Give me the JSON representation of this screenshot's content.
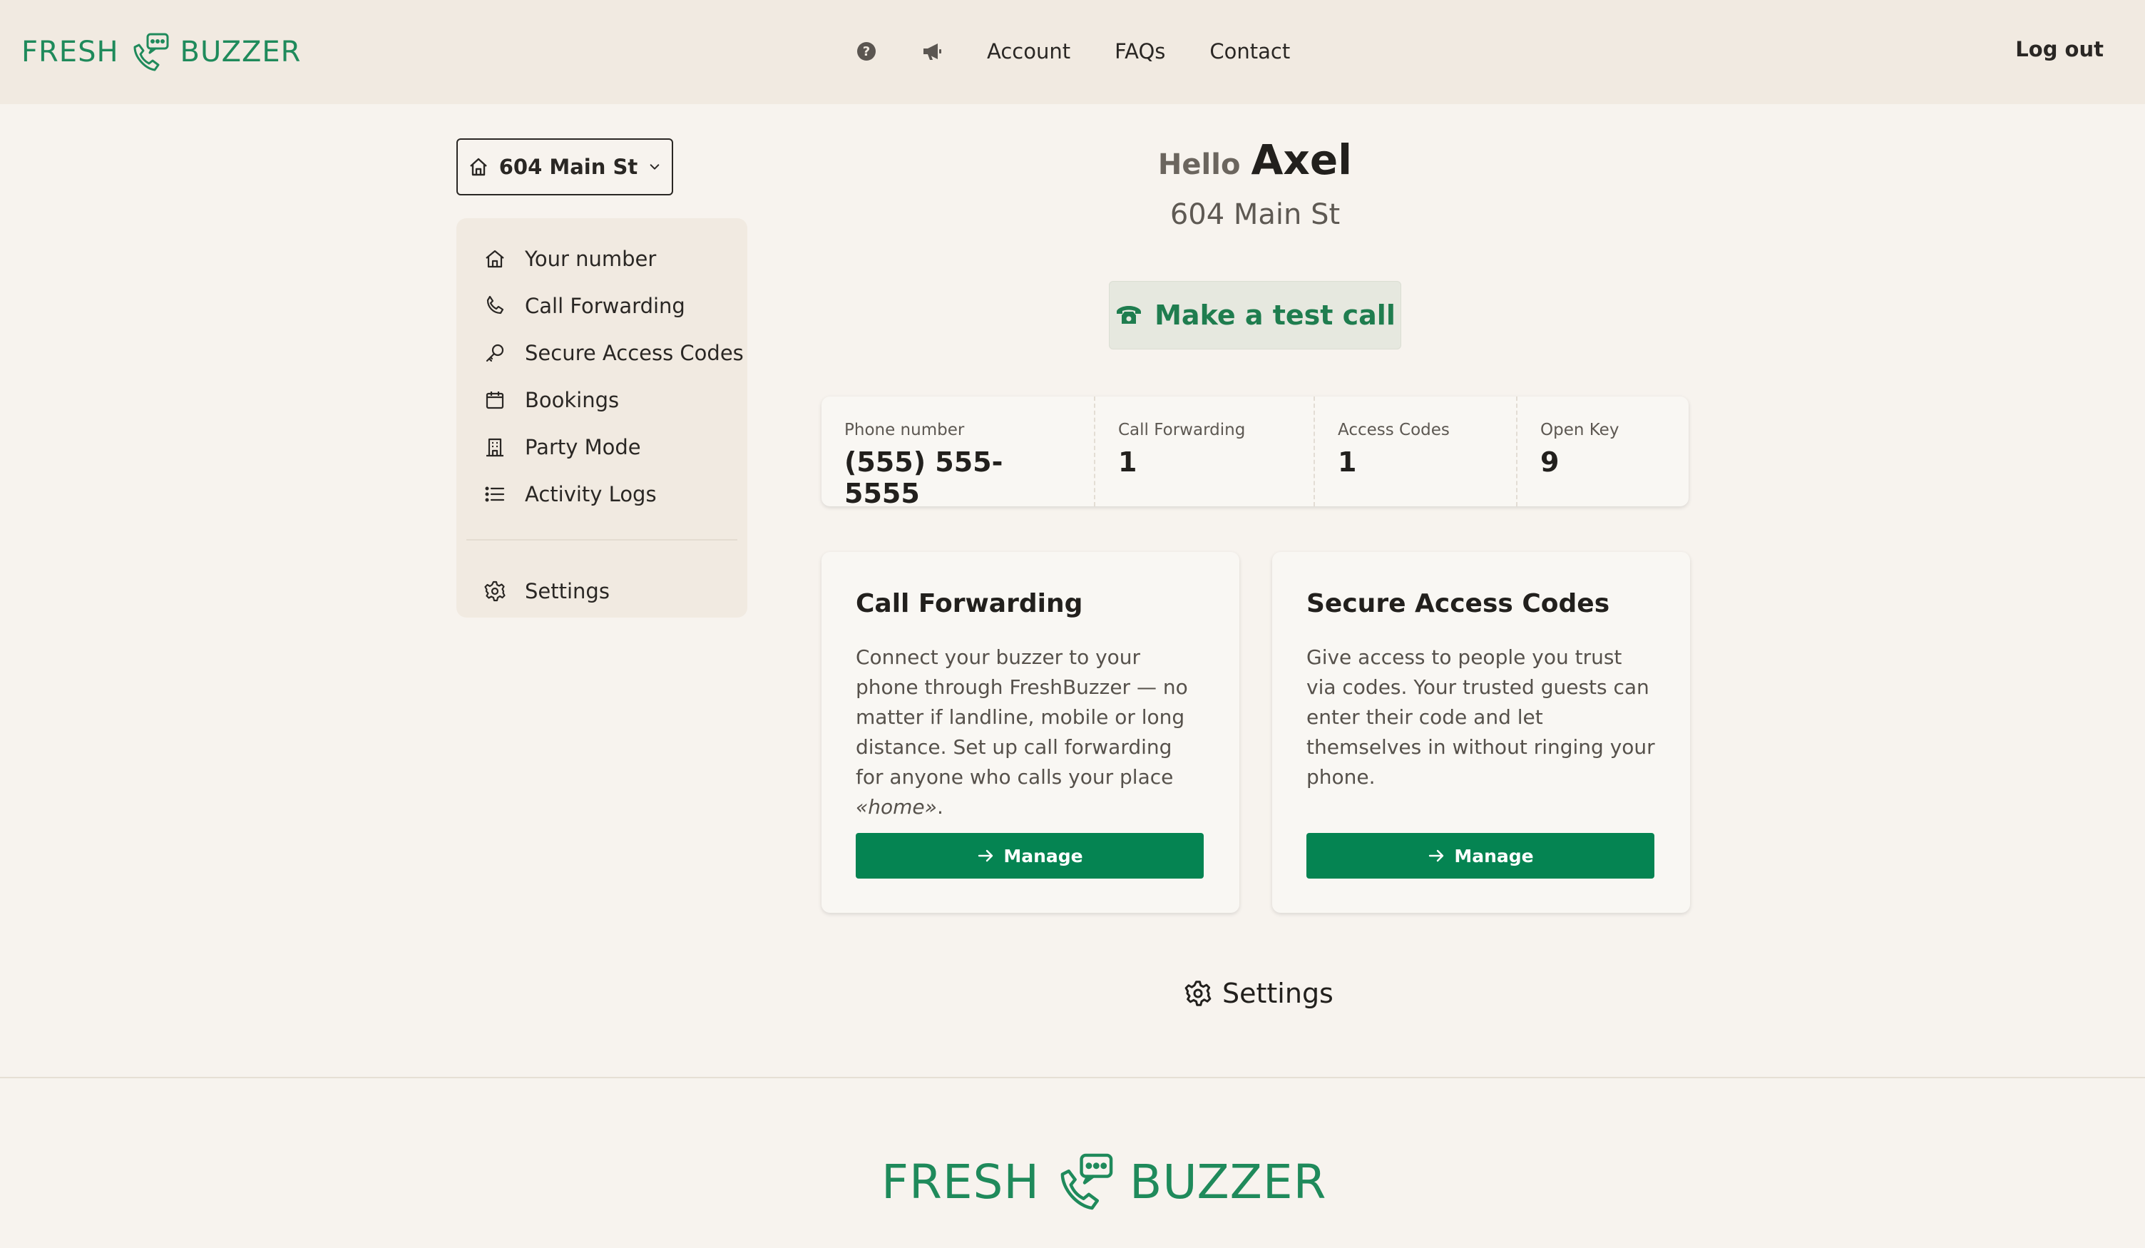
{
  "brand": {
    "left": "FRESH",
    "right": "BUZZER",
    "color": "#1f8a5b"
  },
  "header": {
    "nav": [
      {
        "icon": "help-circle-icon"
      },
      {
        "icon": "megaphone-icon"
      },
      {
        "label": "Account"
      },
      {
        "label": "FAQs"
      },
      {
        "label": "Contact"
      }
    ],
    "logout": "Log out"
  },
  "sidebar": {
    "address_select": {
      "icon": "home-icon",
      "value": "604 Main St"
    },
    "items": [
      {
        "icon": "home-icon",
        "label": "Your number"
      },
      {
        "icon": "phone-icon",
        "label": "Call Forwarding"
      },
      {
        "icon": "key-icon",
        "label": "Secure Access Codes"
      },
      {
        "icon": "calendar-icon",
        "label": "Bookings"
      },
      {
        "icon": "building-icon",
        "label": "Party Mode"
      },
      {
        "icon": "list-icon",
        "label": "Activity Logs"
      }
    ],
    "settings": {
      "icon": "gear-icon",
      "label": "Settings"
    }
  },
  "main": {
    "greeting": "Hello",
    "name": "Axel",
    "address": "604 Main St",
    "test_call": "Make a test call",
    "stats": [
      {
        "label": "Phone number",
        "value": "(555) 555-5555"
      },
      {
        "label": "Call Forwarding",
        "value": "1"
      },
      {
        "label": "Access Codes",
        "value": "1"
      },
      {
        "label": "Open Key",
        "value": "9"
      }
    ],
    "cards": [
      {
        "title": "Call Forwarding",
        "body": "Connect your buzzer to your phone through FreshBuzzer — no matter if landline, mobile or long distance. Set up call forwarding for anyone who calls your place ",
        "body_em": "«home»",
        "body_end": ".",
        "button": "Manage"
      },
      {
        "title": "Secure Access Codes",
        "body": "Give access to people you trust via codes. Your trusted guests can enter their code and let themselves in without ringing your phone.",
        "button": "Manage"
      }
    ],
    "settings_link": "Settings"
  },
  "colors": {
    "accent": "#058452",
    "header_bg": "#f1eae1",
    "page_bg": "#f7f3ee"
  }
}
